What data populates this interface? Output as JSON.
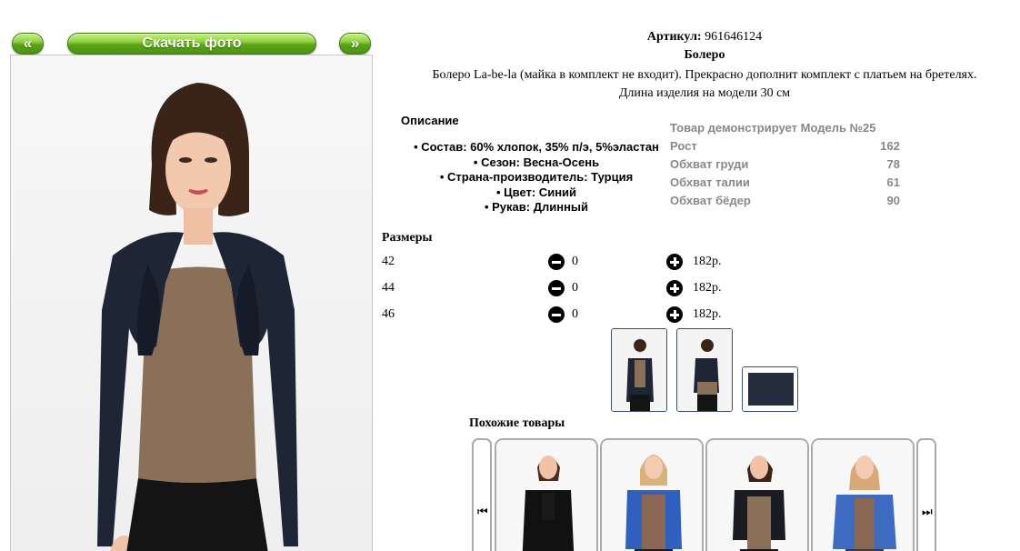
{
  "nav": {
    "prev_label": "«",
    "download_label": "Скачать фото",
    "next_label": "»"
  },
  "product": {
    "article_label": "Артикул:",
    "article_value": "961646124",
    "name": "Болеро",
    "description_line1": "Болеро La-be-la (майка в комплект не входит). Прекрасно дополнит комплект с платьем на бретелях.",
    "description_line2": "Длина изделия на модели 30 см"
  },
  "description": {
    "heading": "Описание",
    "items": [
      "Состав: 60% хлопок, 35% п/э, 5%эластан",
      "Сезон: Весна-Осень",
      "Страна-производитель: Турция",
      "Цвет: Синий",
      "Рукав: Длинный"
    ]
  },
  "model": {
    "title": "Товар демонстрирует Модель №25",
    "rows": [
      {
        "label": "Рост",
        "value": "162"
      },
      {
        "label": "Обхват груди",
        "value": "78"
      },
      {
        "label": "Обхват талии",
        "value": "61"
      },
      {
        "label": "Обхват бёдер",
        "value": "90"
      }
    ]
  },
  "sizes": {
    "heading": "Размеры",
    "rows": [
      {
        "size": "42",
        "qty": "0",
        "price": "182р."
      },
      {
        "size": "44",
        "qty": "0",
        "price": "182р."
      },
      {
        "size": "46",
        "qty": "0",
        "price": "182р."
      }
    ]
  },
  "similar": {
    "heading": "Похожие товары"
  },
  "icons": {
    "minus": "minus-circle-icon",
    "plus": "plus-circle-icon",
    "first": "skip-back-icon",
    "last": "skip-forward-icon"
  },
  "colors": {
    "button_green": "#5aa416",
    "muted_text": "#888888",
    "thumb_border": "#3a4f6e"
  }
}
